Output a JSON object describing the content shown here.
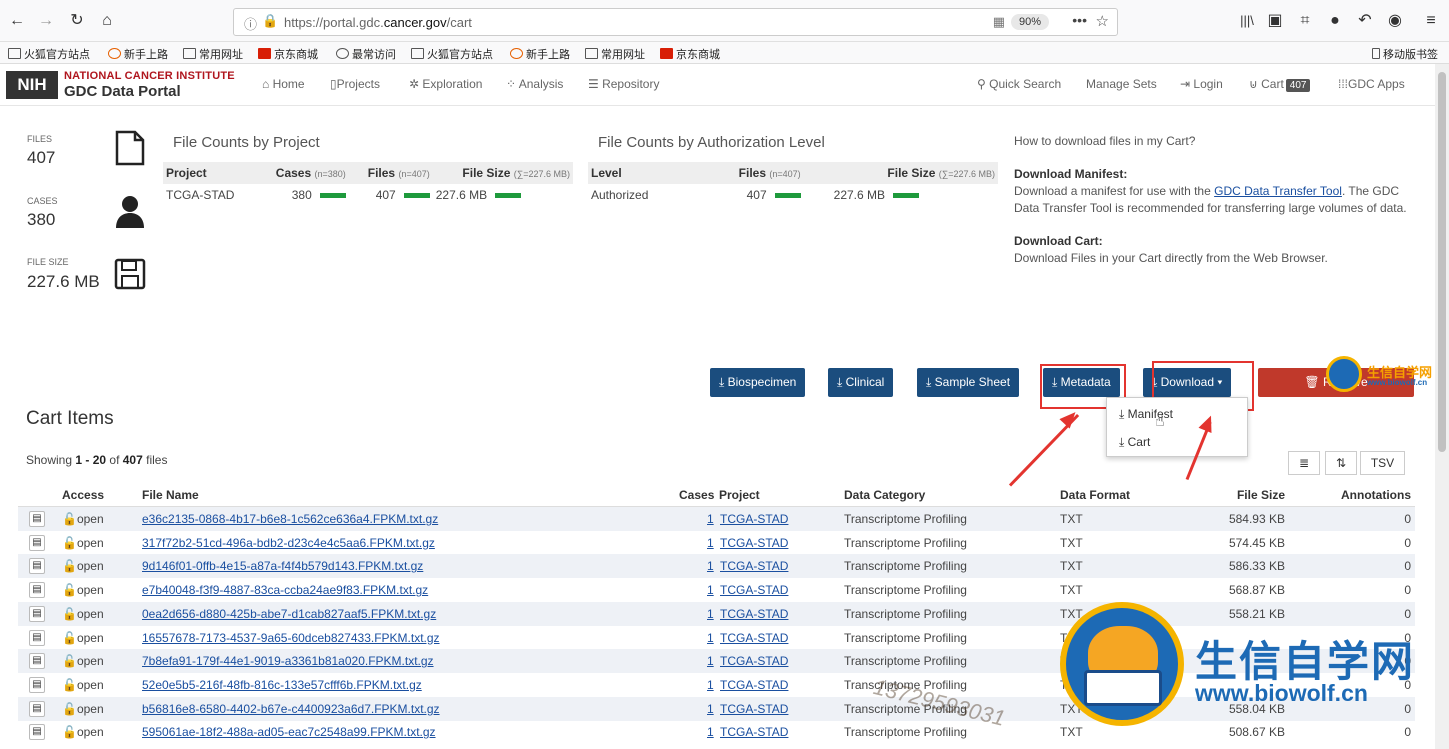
{
  "browser": {
    "url_prefix": "https://portal.gdc.",
    "url_domain": "cancer.gov",
    "url_path": "/cart",
    "zoom": "90%",
    "bookmarks": [
      "火狐官方站点",
      "新手上路",
      "常用网址",
      "京东商城",
      "最常访问",
      "火狐官方站点",
      "新手上路",
      "常用网址",
      "京东商城"
    ],
    "mobile_bookmarks": "移动版书签"
  },
  "portal": {
    "nih": "NIH",
    "nci": "NATIONAL CANCER INSTITUTE",
    "gdc": "GDC Data Portal",
    "nav": [
      "Home",
      "Projects",
      "Exploration",
      "Analysis",
      "Repository"
    ],
    "right_nav": [
      "Quick Search",
      "Manage Sets",
      "Login",
      "Cart",
      "GDC Apps"
    ],
    "cart_count": "407"
  },
  "summary": {
    "files_label": "FILES",
    "files": "407",
    "cases_label": "CASES",
    "cases": "380",
    "size_label": "FILE SIZE",
    "size": "227.6 MB"
  },
  "by_project": {
    "title": "File Counts by Project",
    "headers": [
      "Project",
      "Cases",
      "Files",
      "File Size"
    ],
    "sub": [
      "(n=380)",
      "(n=407)",
      "(∑=227.6 MB)"
    ],
    "row": [
      "TCGA-STAD",
      "380",
      "407",
      "227.6 MB"
    ]
  },
  "by_auth": {
    "title": "File Counts by Authorization Level",
    "headers": [
      "Level",
      "Files",
      "File Size"
    ],
    "sub": [
      "(n=407)",
      "(∑=227.6 MB)"
    ],
    "row": [
      "Authorized",
      "407",
      "227.6 MB"
    ]
  },
  "help": {
    "question": "How to download files in my Cart?",
    "manifest_title": "Download Manifest:",
    "manifest_text1": "Download a manifest for use with the ",
    "manifest_link": "GDC Data Transfer Tool",
    "manifest_text2": ". The GDC Data Transfer Tool is recommended for transferring large volumes of data.",
    "cart_title": "Download Cart:",
    "cart_text": "Download Files in your Cart directly from the Web Browser."
  },
  "buttons": {
    "biospecimen": "Biospecimen",
    "clinical": "Clinical",
    "sample_sheet": "Sample Sheet",
    "metadata": "Metadata",
    "download": "Download",
    "remove": "Remove"
  },
  "dropdown": {
    "manifest": "Manifest",
    "cart": "Cart"
  },
  "cart": {
    "title": "Cart Items",
    "showing_prefix": "Showing ",
    "showing_range": "1 - 20",
    "showing_of": " of ",
    "showing_total": "407",
    "showing_suffix": " files",
    "tsv": "TSV",
    "columns": [
      "Access",
      "File Name",
      "Cases",
      "Project",
      "Data Category",
      "Data Format",
      "File Size",
      "Annotations"
    ],
    "rows": [
      {
        "access": "open",
        "file": "e36c2135-0868-4b17-b6e8-1c562ce636a4.FPKM.txt.gz",
        "cases": "1",
        "project": "TCGA-STAD",
        "category": "Transcriptome Profiling",
        "format": "TXT",
        "size": "584.93 KB",
        "ann": "0"
      },
      {
        "access": "open",
        "file": "317f72b2-51cd-496a-bdb2-d23c4e4c5aa6.FPKM.txt.gz",
        "cases": "1",
        "project": "TCGA-STAD",
        "category": "Transcriptome Profiling",
        "format": "TXT",
        "size": "574.45 KB",
        "ann": "0"
      },
      {
        "access": "open",
        "file": "9d146f01-0ffb-4e15-a87a-f4f4b579d143.FPKM.txt.gz",
        "cases": "1",
        "project": "TCGA-STAD",
        "category": "Transcriptome Profiling",
        "format": "TXT",
        "size": "586.33 KB",
        "ann": "0"
      },
      {
        "access": "open",
        "file": "e7b40048-f3f9-4887-83ca-ccba24ae9f83.FPKM.txt.gz",
        "cases": "1",
        "project": "TCGA-STAD",
        "category": "Transcriptome Profiling",
        "format": "TXT",
        "size": "568.87 KB",
        "ann": "0"
      },
      {
        "access": "open",
        "file": "0ea2d656-d880-425b-abe7-d1cab827aaf5.FPKM.txt.gz",
        "cases": "1",
        "project": "TCGA-STAD",
        "category": "Transcriptome Profiling",
        "format": "TXT",
        "size": "558.21 KB",
        "ann": "0"
      },
      {
        "access": "open",
        "file": "16557678-7173-4537-9a65-60dceb827433.FPKM.txt.gz",
        "cases": "1",
        "project": "TCGA-STAD",
        "category": "Transcriptome Profiling",
        "format": "TXT",
        "size": "",
        "ann": "0"
      },
      {
        "access": "open",
        "file": "7b8efa91-179f-44e1-9019-a3361b81a020.FPKM.txt.gz",
        "cases": "1",
        "project": "TCGA-STAD",
        "category": "Transcriptome Profiling",
        "format": "TXT",
        "size": "",
        "ann": "0"
      },
      {
        "access": "open",
        "file": "52e0e5b5-216f-48fb-816c-133e57cfff6b.FPKM.txt.gz",
        "cases": "1",
        "project": "TCGA-STAD",
        "category": "Transcriptome Profiling",
        "format": "TXT",
        "size": "",
        "ann": "0"
      },
      {
        "access": "open",
        "file": "b56816e8-6580-4402-b67e-c4400923a6d7.FPKM.txt.gz",
        "cases": "1",
        "project": "TCGA-STAD",
        "category": "Transcriptome Profiling",
        "format": "TXT",
        "size": "558.04 KB",
        "ann": "0"
      },
      {
        "access": "open",
        "file": "595061ae-18f2-488a-ad05-eac7c2548a99.FPKM.txt.gz",
        "cases": "1",
        "project": "TCGA-STAD",
        "category": "Transcriptome Profiling",
        "format": "TXT",
        "size": "508.67 KB",
        "ann": "0"
      }
    ]
  },
  "watermark": {
    "cn": "生信自学网",
    "url": "www.biowolf.cn",
    "phone": "13729593031"
  }
}
